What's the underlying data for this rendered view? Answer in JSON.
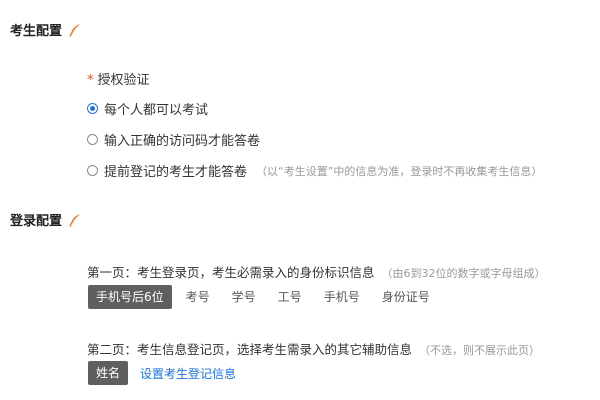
{
  "exam_config": {
    "title": "考生配置",
    "auth_required_mark": "*",
    "auth_label": "授权验证",
    "options": [
      {
        "label": "每个人都可以考试",
        "checked": true
      },
      {
        "label": "输入正确的访问码才能答卷",
        "checked": false
      },
      {
        "label": "提前登记的考生才能答卷",
        "checked": false,
        "hint": "（以“考生设置”中的信息为准，登录时不再收集考生信息）"
      }
    ]
  },
  "login_config": {
    "title": "登录配置",
    "page1": {
      "text": "第一页：考生登录页，考生必需录入的身份标识信息",
      "hint": "（由6到32位的数字或字母组成）",
      "tags": [
        "手机号后6位",
        "考号",
        "学号",
        "工号",
        "手机号",
        "身份证号"
      ],
      "selected_index": 0
    },
    "page2": {
      "text": "第二页：考生信息登记页，选择考生需录入的其它辅助信息",
      "hint": "（不选，则不展示此页）",
      "tags": [
        "姓名"
      ],
      "link": "设置考生登记信息"
    }
  },
  "colors": {
    "accent": "#1a73e8",
    "required": "#e8492f",
    "icon": "#f07a2c",
    "selected_tag": "#5f5f5f"
  },
  "icons": {
    "section": "feather-pen-icon"
  }
}
